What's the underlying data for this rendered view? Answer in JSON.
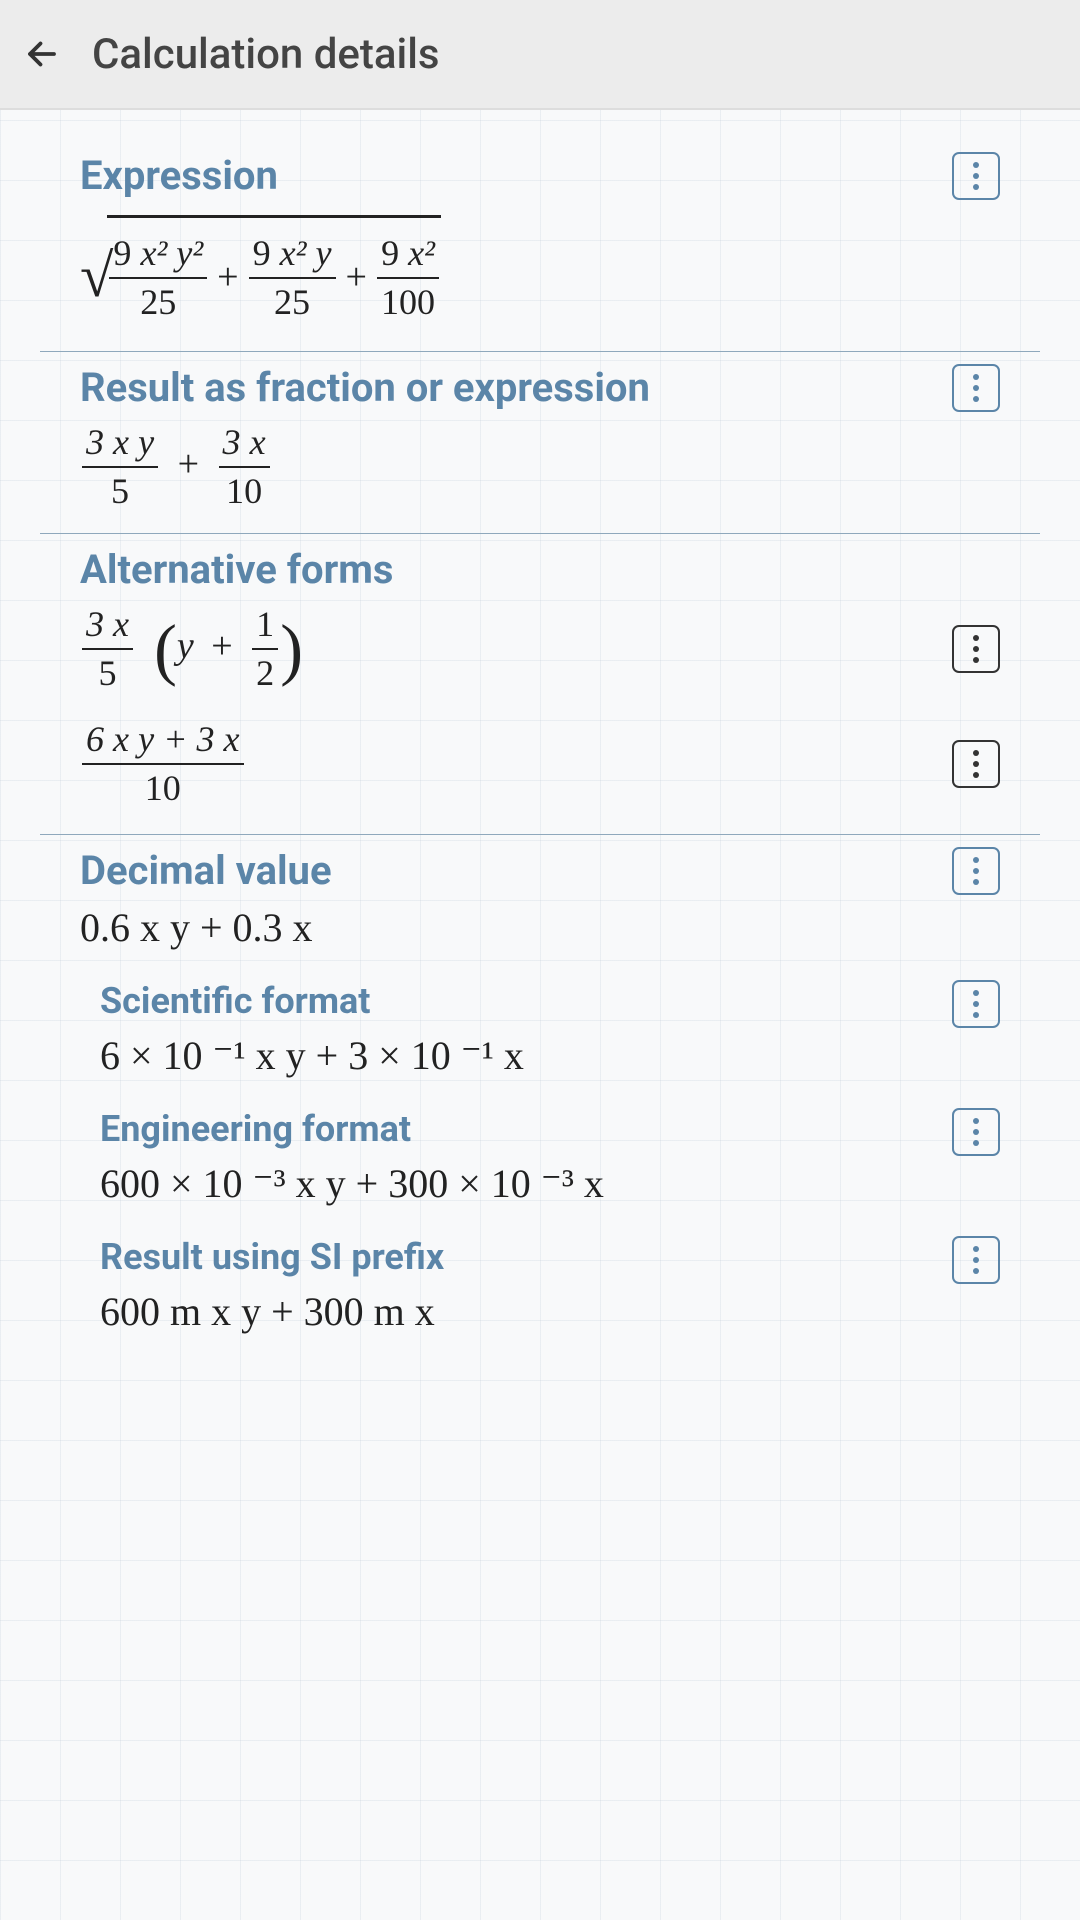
{
  "header": {
    "title": "Calculation details"
  },
  "sections": {
    "expression": {
      "title": "Expression",
      "terms": [
        {
          "num_coef": "9",
          "num_vars": "x² y²",
          "den": "25"
        },
        {
          "num_coef": "9",
          "num_vars": "x² y",
          "den": "25"
        },
        {
          "num_coef": "9",
          "num_vars": "x²",
          "den": "100"
        }
      ]
    },
    "fraction_result": {
      "title": "Result as fraction or expression",
      "terms": [
        {
          "num": "3 x y",
          "den": "5"
        },
        {
          "num": "3 x",
          "den": "10"
        }
      ]
    },
    "alternative": {
      "title": "Alternative forms",
      "form1": {
        "lead_num": "3 x",
        "lead_den": "5",
        "inside_var": "y",
        "inside_frac_num": "1",
        "inside_frac_den": "2"
      },
      "form2": {
        "num": "6 x y + 3 x",
        "den": "10"
      }
    },
    "decimal": {
      "title": "Decimal value",
      "value": "0.6 x y + 0.3 x"
    },
    "scientific": {
      "title": "Scientific format",
      "value": "6 × 10 ⁻¹ x y + 3 × 10 ⁻¹ x"
    },
    "engineering": {
      "title": "Engineering format",
      "value": "600 × 10 ⁻³ x y + 300 × 10 ⁻³ x"
    },
    "si_prefix": {
      "title": "Result using SI prefix",
      "value": "600 m x y + 300 m x"
    }
  },
  "glyphs": {
    "plus": "+",
    "sqrt": "√",
    "lparen": "(",
    "rparen": ")"
  }
}
